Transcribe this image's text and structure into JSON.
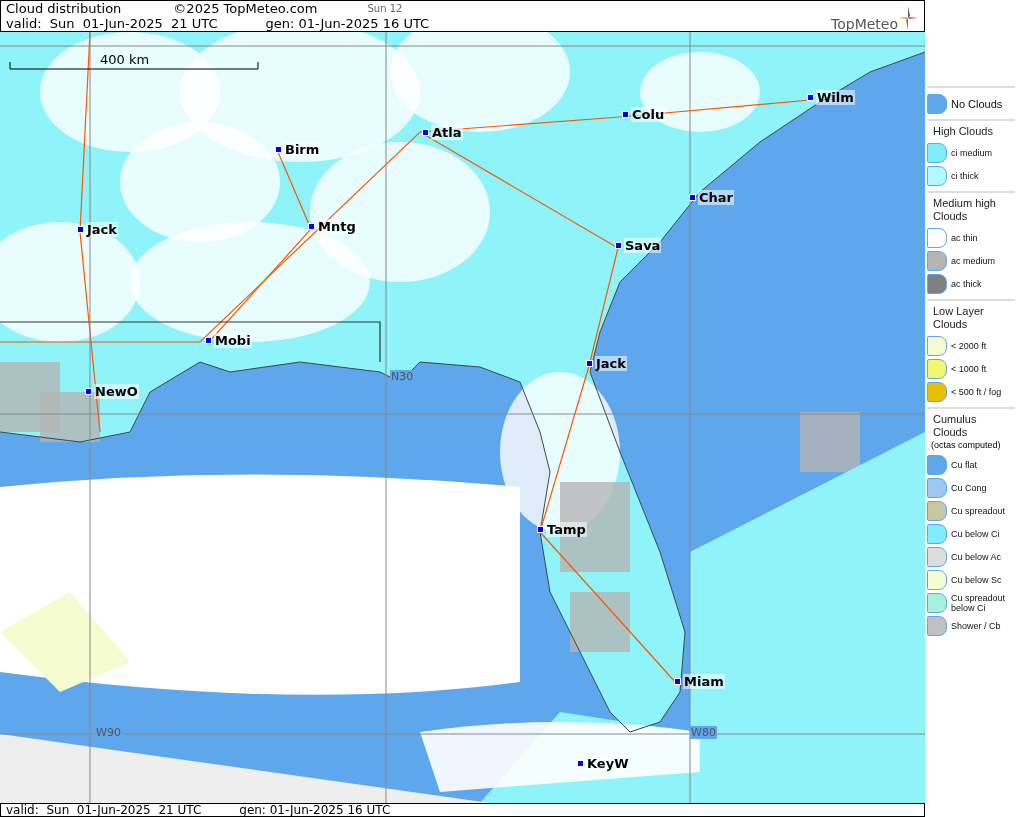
{
  "header": {
    "title": "Cloud distribution",
    "copyright": "©2025 TopMeteo.com",
    "day_tab": "Sun 12",
    "valid": "valid:  Sun  01-Jun-2025  21 UTC",
    "generated": "gen: 01-Jun-2025 16 UTC",
    "logo": "TopMeteo"
  },
  "map": {
    "scale": "400 km",
    "cities": [
      {
        "name": "Birm"
      },
      {
        "name": "Atla"
      },
      {
        "name": "Colu"
      },
      {
        "name": "Wilm"
      },
      {
        "name": "Char"
      },
      {
        "name": "Jack"
      },
      {
        "name": "Mntg"
      },
      {
        "name": "Sava"
      },
      {
        "name": "Mobi"
      },
      {
        "name": "Jack"
      },
      {
        "name": "NewO"
      },
      {
        "name": "Tamp"
      },
      {
        "name": "Miam"
      },
      {
        "name": "KeyW"
      }
    ],
    "grid_labels": [
      {
        "text": "N30"
      },
      {
        "text": "W90"
      },
      {
        "text": "W80"
      }
    ]
  },
  "legend": {
    "sections": [
      {
        "items": [
          {
            "label": "No Clouds",
            "color": "#5ea7ec"
          }
        ]
      },
      {
        "title": "High Clouds",
        "items": [
          {
            "label": "ci medium",
            "color": "#80eefa"
          },
          {
            "label": "ci thick",
            "color": "#b2fafc"
          }
        ]
      },
      {
        "title": "Medium high Clouds",
        "items": [
          {
            "label": "ac thin",
            "color": "#ffffff"
          },
          {
            "label": "ac medium",
            "color": "#b4b4b4"
          },
          {
            "label": "ac thick",
            "color": "#808080"
          }
        ]
      },
      {
        "title": "Low Layer Clouds",
        "items": [
          {
            "label": "< 2000 ft",
            "color": "#f4fcd0"
          },
          {
            "label": "< 1000 ft",
            "color": "#f0f870"
          },
          {
            "label": "< 500 ft / fog",
            "color": "#e8c000"
          }
        ]
      },
      {
        "title": "Cumulus Clouds",
        "subtitle": "(octas computed)",
        "items": [
          {
            "label": "Cu flat",
            "color": "#5ea7ec"
          },
          {
            "label": "Cu Cong",
            "color": "#9cc8f2"
          },
          {
            "label": "Cu spreadout",
            "color": "#c8c8a0"
          },
          {
            "label": "Cu below Ci",
            "color": "#80eefa"
          },
          {
            "label": "Cu below Ac",
            "color": "#dddddd"
          },
          {
            "label": "Cu below Sc",
            "color": "#f4fcd0"
          },
          {
            "label": "Cu spreadout below Ci",
            "color": "#a8f0e0"
          },
          {
            "label": "Shower / Cb",
            "color": "#c0c0c0"
          }
        ]
      }
    ]
  },
  "footer": {
    "valid": "valid:  Sun  01-Jun-2025  21 UTC",
    "generated": "gen: 01-Jun-2025 16 UTC"
  }
}
